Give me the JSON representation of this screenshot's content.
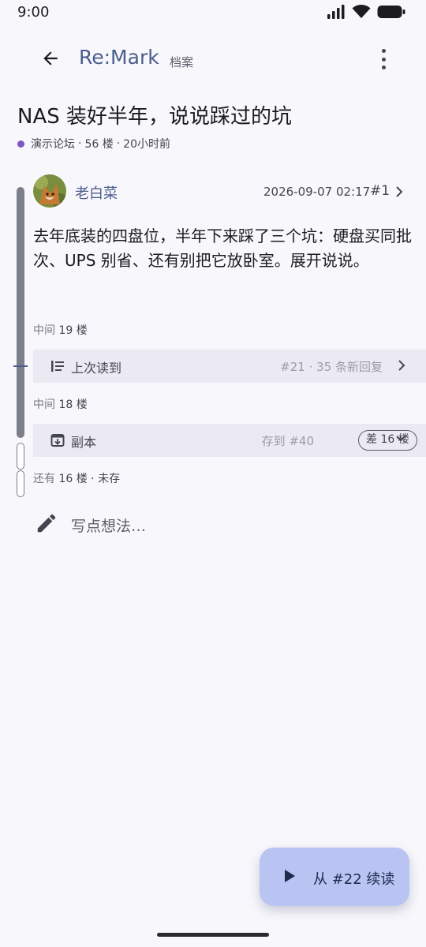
{
  "status_bar": {
    "time": "9:00"
  },
  "app_bar": {
    "title": "Re:Mark",
    "subtitle": "档案"
  },
  "thread": {
    "title": "NAS 装好半年，说说踩过的坑",
    "forum": "演示论坛",
    "floors": "56 楼",
    "age": "20小时前",
    "forum_color": "#7e57c2"
  },
  "post": {
    "author": "老白菜",
    "date": "2026-09-07 02:17",
    "floor": "#1",
    "body": "去年底装的四盘位，半年下来踩了三个坑：硬盘买同批次、UPS 别省、还有别把它放卧室。展开说说。"
  },
  "gaps": [
    {
      "prefix": "中间",
      "count": "19",
      "suffix": "楼"
    },
    {
      "prefix": "中间",
      "count": "18",
      "suffix": "楼"
    },
    {
      "prefix": "还有",
      "count": "16",
      "suffix": "楼 · 未存"
    }
  ],
  "last_read": {
    "label": "上次读到",
    "info": "#21 · 35 条新回复"
  },
  "snapshot": {
    "label": "副本",
    "info": "存到 #40",
    "diff": "差 16 楼"
  },
  "compose": {
    "placeholder": "写点想法…"
  },
  "fab": {
    "label": "从 #22 续读"
  },
  "colors": {
    "accent": "#4b5d8c",
    "background": "#f8f7fc",
    "row_bg": "#ebeaf2",
    "fab_bg": "#b9c4f2"
  }
}
